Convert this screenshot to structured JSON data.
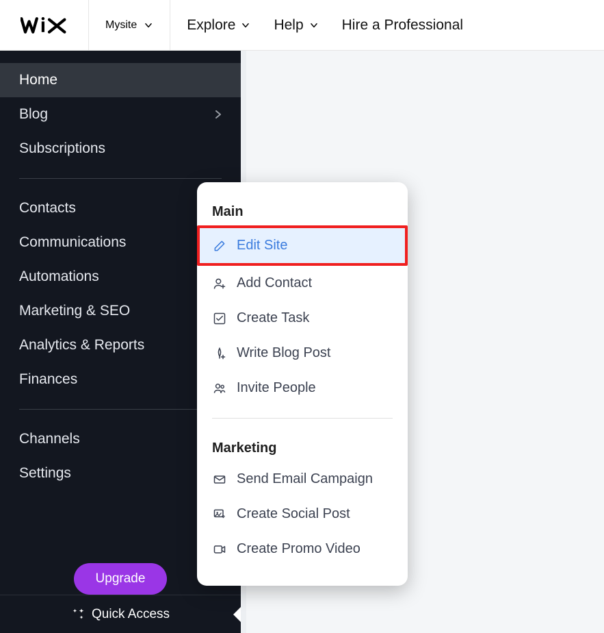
{
  "topbar": {
    "site_menu_label": "Mysite",
    "explore_label": "Explore",
    "help_label": "Help",
    "hire_label": "Hire a Professional"
  },
  "sidebar": {
    "items": [
      {
        "label": "Home",
        "active": true
      },
      {
        "label": "Blog"
      },
      {
        "label": "Subscriptions"
      }
    ],
    "group2": [
      {
        "label": "Contacts"
      },
      {
        "label": "Communications"
      },
      {
        "label": "Automations"
      },
      {
        "label": "Marketing & SEO"
      },
      {
        "label": "Analytics & Reports"
      },
      {
        "label": "Finances"
      }
    ],
    "group3": [
      {
        "label": "Channels"
      },
      {
        "label": "Settings"
      }
    ],
    "upgrade_label": "Upgrade",
    "quick_access_label": "Quick Access"
  },
  "popup": {
    "section_main": "Main",
    "main_items": [
      {
        "label": "Edit Site",
        "highlight": true
      },
      {
        "label": "Add Contact"
      },
      {
        "label": "Create Task"
      },
      {
        "label": "Write Blog Post"
      },
      {
        "label": "Invite People"
      }
    ],
    "section_marketing": "Marketing",
    "marketing_items": [
      {
        "label": "Send Email Campaign"
      },
      {
        "label": "Create Social Post"
      },
      {
        "label": "Create Promo Video"
      }
    ]
  }
}
